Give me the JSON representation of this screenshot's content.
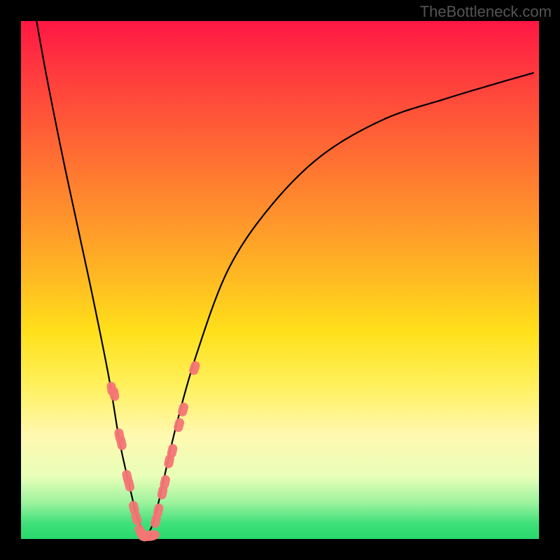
{
  "watermark": "TheBottleneck.com",
  "chart_data": {
    "type": "line",
    "title": "",
    "xlabel": "",
    "ylabel": "",
    "xlim": [
      0,
      100
    ],
    "ylim": [
      0,
      100
    ],
    "grid": false,
    "legend": false,
    "note": "Axes are unlabeled; x is a normalized performance-ratio axis (0–100) and y is bottleneck percentage (0 = no bottleneck at bottom, 100 = full bottleneck at top). Values are estimated from pixel positions.",
    "series": [
      {
        "name": "bottleneck-curve",
        "style": "line",
        "color": "#000000",
        "x": [
          3,
          5,
          8,
          11,
          14,
          17,
          19,
          21,
          22.5,
          24,
          25.5,
          27,
          30,
          34,
          40,
          48,
          58,
          70,
          82,
          92,
          99
        ],
        "y": [
          100,
          89,
          74,
          60,
          46,
          31,
          19,
          10,
          4,
          1,
          3,
          9,
          22,
          36,
          52,
          64,
          74,
          81,
          85,
          88,
          90
        ]
      },
      {
        "name": "sample-points-left",
        "style": "scatter",
        "color": "#f47575",
        "x": [
          17.5,
          18.0,
          19.0,
          19.4,
          20.5,
          20.9,
          21.8,
          22.3,
          23.0,
          23.6
        ],
        "y": [
          29.0,
          28.0,
          20.0,
          18.5,
          12.0,
          10.5,
          6.0,
          4.0,
          1.5,
          0.8
        ]
      },
      {
        "name": "sample-points-bottom",
        "style": "scatter",
        "color": "#f47575",
        "x": [
          24.0,
          24.5,
          25.0,
          25.4
        ],
        "y": [
          0.5,
          0.5,
          0.6,
          0.8
        ]
      },
      {
        "name": "sample-points-right",
        "style": "scatter",
        "color": "#f47575",
        "x": [
          26.0,
          26.5,
          27.3,
          27.8,
          28.6,
          29.2,
          30.5,
          31.3,
          33.5
        ],
        "y": [
          3.5,
          5.5,
          9.0,
          11.0,
          15.0,
          17.0,
          22.0,
          25.0,
          33.0
        ]
      }
    ]
  }
}
